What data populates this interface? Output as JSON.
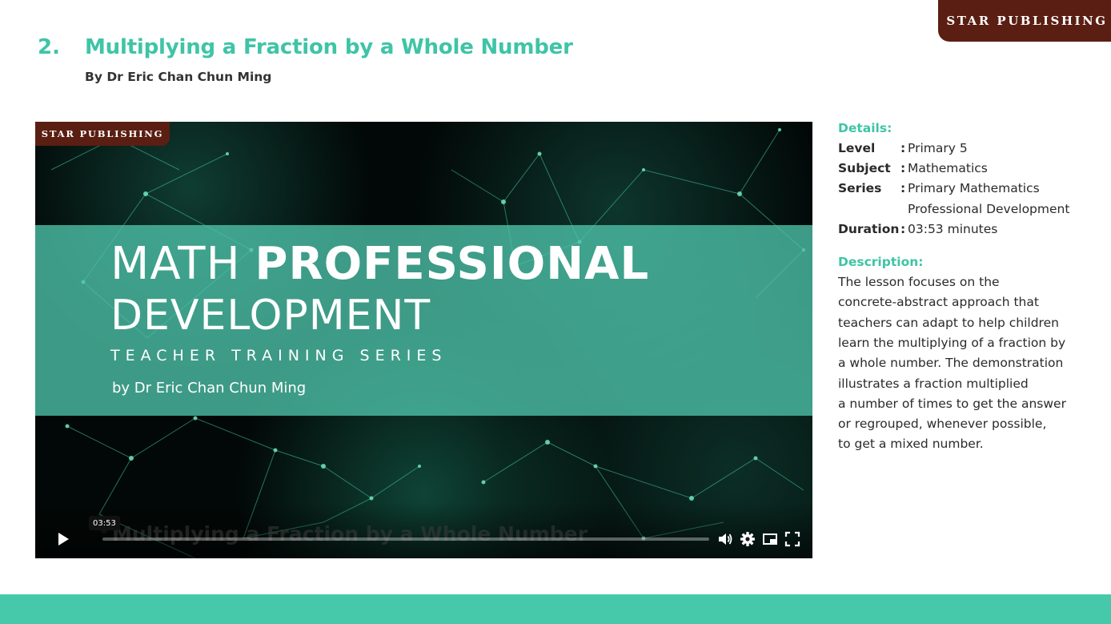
{
  "brand": {
    "label": "Star Publishing"
  },
  "heading": {
    "number": "2.",
    "title": "Multiplying a Fraction by a Whole Number",
    "author": "By Dr Eric Chan Chun Ming"
  },
  "video": {
    "logo": "Star Publishing",
    "title_light": "MATH",
    "title_bold": "PROFESSIONAL",
    "title_line2": "DEVELOPMENT",
    "series_label": "TEACHER TRAINING SERIES",
    "byline": "by Dr Eric Chan Chun Ming",
    "overlay_title": "Multiplying a Fraction by a Whole Number",
    "duration_tooltip": "03:53",
    "progress": 0.0,
    "icons": [
      "play-icon",
      "volume-icon",
      "settings-icon",
      "picture-in-picture-icon",
      "fullscreen-icon"
    ]
  },
  "details": {
    "heading": "Details:",
    "rows": [
      {
        "key": "Level",
        "value": "Primary 5"
      },
      {
        "key": "Subject",
        "value": "Mathematics"
      },
      {
        "key": "Series",
        "value": "Primary Mathematics",
        "value2": "Professional Development"
      },
      {
        "key": "Duration",
        "value": "03:53 minutes"
      }
    ],
    "separator": ":"
  },
  "description": {
    "heading": "Description:",
    "lines": [
      "The lesson focuses on the",
      "concrete-abstract approach that",
      "teachers can adapt to help children",
      "learn the multiplying of a fraction by",
      "a whole number. The demonstration",
      "illustrates a fraction multiplied",
      "a number of times to get the answer",
      "or regrouped, whenever possible,",
      "to get a mixed number."
    ]
  },
  "colors": {
    "accent": "#3fc4a6",
    "brand": "#5b1e12",
    "footer": "#45c9aa"
  }
}
